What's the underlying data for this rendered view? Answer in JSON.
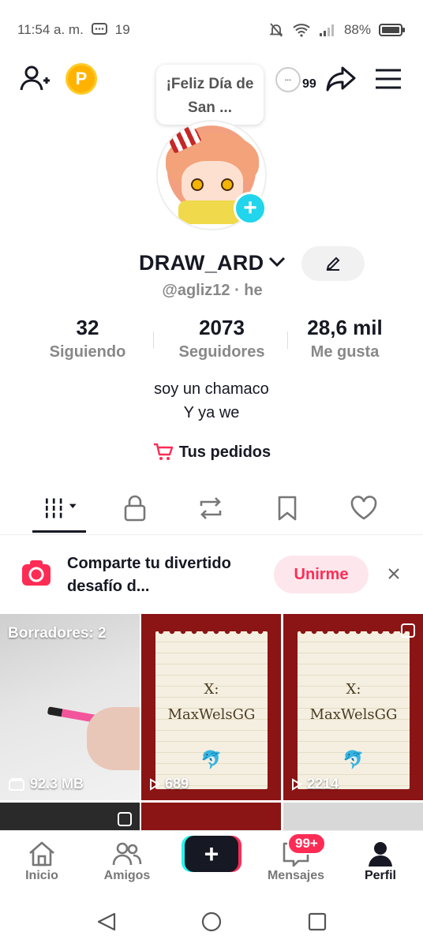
{
  "status_bar": {
    "time": "11:54 a. m.",
    "notif_count": "19",
    "battery": "88%"
  },
  "top_bar": {
    "coin_letter": "P",
    "bubble_text": "¡Feliz Día de San ...",
    "streak_count": "99"
  },
  "profile": {
    "display_name": "DRAW_ARD",
    "handle": "@agliz12 · he",
    "stats": {
      "following_count": "32",
      "following_label": "Siguiendo",
      "followers_count": "2073",
      "followers_label": "Seguidores",
      "likes_count": "28,6 mil",
      "likes_label": "Me gusta"
    },
    "bio_line1": "soy un chamaco",
    "bio_line2": "Y ya we",
    "orders_label": "Tus pedidos"
  },
  "banner": {
    "text": "Comparte tu divertido desafío d...",
    "join_label": "Unirme"
  },
  "grid": {
    "draft_label": "Borradores: 2",
    "draft_size": "92.3 MB",
    "video1_text_x": "X:",
    "video1_text_name": "MaxWelsGG",
    "video1_views": "689",
    "video2_text_x": "X:",
    "video2_text_name": "MaxWelsGG",
    "video2_views": "2214"
  },
  "bottom_nav": {
    "home": "Inicio",
    "friends": "Amigos",
    "messages": "Mensajes",
    "messages_badge": "99+",
    "profile": "Perfil"
  },
  "colors": {
    "accent_red": "#fe2c55",
    "accent_cyan": "#25f4ee",
    "avatar_plus": "#20d5ec"
  }
}
